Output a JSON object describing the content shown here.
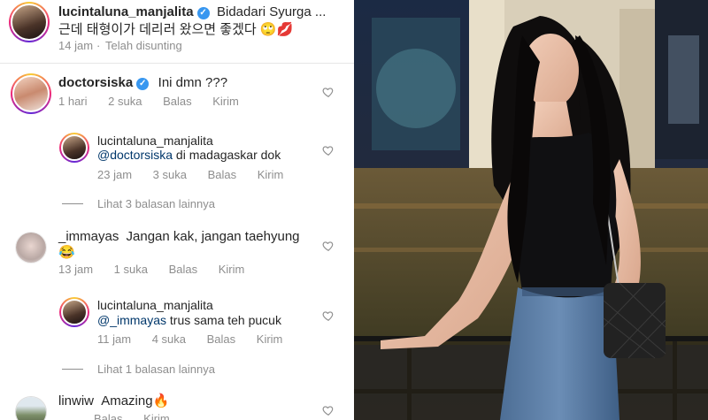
{
  "caption": {
    "username": "lucintaluna_manjalita",
    "text_line1": "Bidadari Syurga ...",
    "text_line2": "근데 태형이가 데리러 왔으면 좋겠다 🙄💋",
    "time": "14 jam",
    "edited": "Telah disunting"
  },
  "comments": [
    {
      "username": "doctorsiska",
      "text": "Ini dmn ???",
      "time": "1 hari",
      "likes": "2 suka",
      "reply": "Balas",
      "send": "Kirim",
      "replies": [
        {
          "username": "lucintaluna_manjalita",
          "mention": "@doctorsiska",
          "text": " di madagaskar dok",
          "time": "23 jam",
          "likes": "3 suka",
          "reply": "Balas",
          "send": "Kirim"
        }
      ],
      "more_replies": "Lihat 3 balasan lainnya"
    },
    {
      "username": "_immayas",
      "text": "Jangan kak, jangan taehyung",
      "text2": "😂",
      "time": "13 jam",
      "likes": "1 suka",
      "reply": "Balas",
      "send": "Kirim",
      "replies": [
        {
          "username": "lucintaluna_manjalita",
          "mention": "@_immayas",
          "text": " trus sama teh pucuk",
          "time": "11 jam",
          "likes": "4 suka",
          "reply": "Balas",
          "send": "Kirim"
        }
      ],
      "more_replies": "Lihat 1 balasan lainnya"
    },
    {
      "username": "linwiw",
      "text": "Amazing🔥",
      "time": "",
      "likes": "",
      "reply": "Balas",
      "send": "Kirim"
    }
  ],
  "icons": {
    "verified": "verified-badge-icon",
    "heart": "heart-icon"
  },
  "colors": {
    "username": "#262626",
    "meta": "#8e8e8e",
    "mention": "#00376b",
    "verified": "#3897f0"
  }
}
